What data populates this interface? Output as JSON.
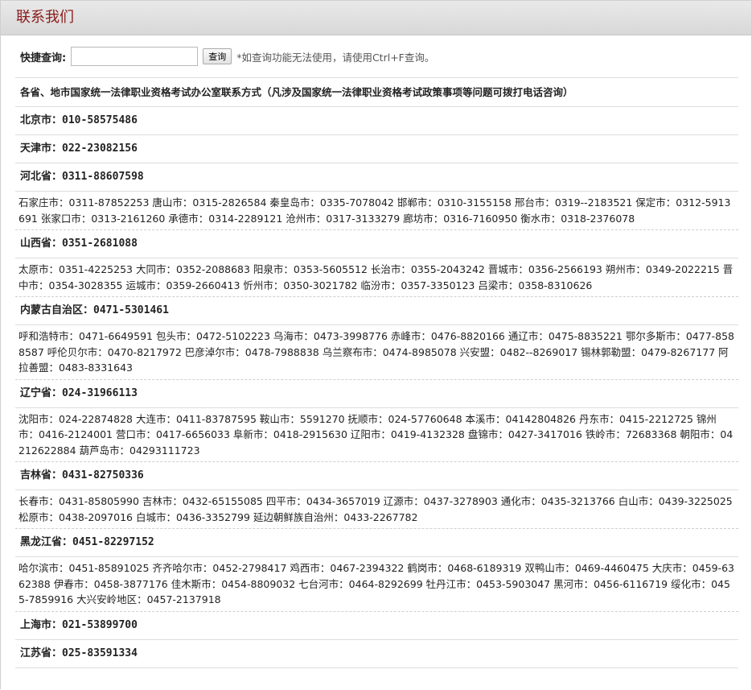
{
  "header": {
    "title": "联系我们"
  },
  "search": {
    "label": "快捷查询:",
    "placeholder": "",
    "button_label": "查询",
    "hint": "*如查询功能无法使用，请使用Ctrl+F查询。"
  },
  "notice": "各省、地市国家统一法律职业资格考试办公室联系方式（凡涉及国家统一法律职业资格考试政策事项等问题可拨打电话咨询）",
  "provinces": [
    {
      "name": "北京市：",
      "phone": "010-58575486",
      "cities": ""
    },
    {
      "name": "天津市：",
      "phone": "022-23082156",
      "cities": ""
    },
    {
      "name": "河北省：",
      "phone": "0311-88607598",
      "cities": "石家庄市：0311-87852253 唐山市：0315-2826584 秦皇岛市：0335-7078042 邯郸市：0310-3155158 邢台市：0319--2183521 保定市：0312-5913691 张家口市：0313-2161260 承德市：0314-2289121 沧州市：0317-3133279 廊坊市：0316-7160950 衡水市：0318-2376078"
    },
    {
      "name": "山西省：",
      "phone": "0351-2681088",
      "cities": "太原市：0351-4225253 大同市：0352-2088683 阳泉市：0353-5605512 长治市：0355-2043242 晋城市：0356-2566193 朔州市：0349-2022215 晋中市：0354-3028355 运城市：0359-2660413 忻州市：0350-3021782 临汾市：0357-3350123 吕梁市：0358-8310626"
    },
    {
      "name": "内蒙古自治区：",
      "phone": "0471-5301461",
      "cities": "呼和浩特市：0471-6649591 包头市：0472-5102223 乌海市：0473-3998776 赤峰市：0476-8820166 通辽市：0475-8835221 鄂尔多斯市：0477-8588587 呼伦贝尔市：0470-8217972 巴彦淖尔市：0478-7988838 乌兰察布市：0474-8985078 兴安盟：0482--8269017 锡林郭勒盟：0479-8267177 阿拉善盟：0483-8331643"
    },
    {
      "name": "辽宁省：",
      "phone": "024-31966113",
      "cities": "沈阳市：024-22874828 大连市：0411-83787595 鞍山市：5591270 抚顺市：024-57760648 本溪市：04142804826 丹东市：0415-2212725 锦州市：0416-2124001 营口市：0417-6656033 阜新市：0418-2915630 辽阳市：0419-4132328 盘锦市：0427-3417016 铁岭市：72683368 朝阳市：04212622884 葫芦岛市：04293111723"
    },
    {
      "name": "吉林省：",
      "phone": "0431-82750336",
      "cities": "长春市：0431-85805990 吉林市：0432-65155085 四平市：0434-3657019 辽源市：0437-3278903 通化市：0435-3213766 白山市：0439-3225025 松原市：0438-2097016 白城市：0436-3352799 延边朝鲜族自治州：0433-2267782"
    },
    {
      "name": "黑龙江省：",
      "phone": "0451-82297152",
      "cities": "哈尔滨市：0451-85891025 齐齐哈尔市：0452-2798417 鸡西市：0467-2394322 鹤岗市：0468-6189319 双鸭山市：0469-4460475 大庆市：0459-6362388 伊春市：0458-3877176 佳木斯市：0454-8809032 七台河市：0464-8292699 牡丹江市：0453-5903047 黑河市：0456-6116719 绥化市：0455-7859916 大兴安岭地区：0457-2137918"
    },
    {
      "name": "上海市：",
      "phone": "021-53899700",
      "cities": ""
    },
    {
      "name": "江苏省：",
      "phone": "025-83591334",
      "cities": ""
    }
  ]
}
